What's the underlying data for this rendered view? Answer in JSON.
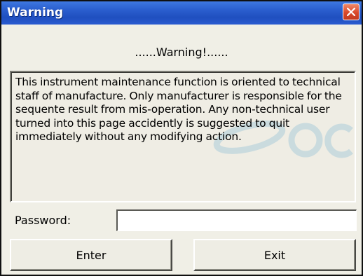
{
  "window": {
    "title": "Warning"
  },
  "dialog": {
    "heading": "......Warning!......",
    "message": "This instrument maintenance function is oriented to technical staff of manufacture. Only manufacturer is responsible for the sequente result from mis-operation. Any non-technical user turned into this page accidently is suggested to quit immediately without any modifying action.",
    "password_label": "Password:",
    "password_value": "",
    "enter_label": "Enter",
    "exit_label": "Exit"
  },
  "icons": {
    "close": "close-icon",
    "watermark": "logo-watermark"
  },
  "colors": {
    "titlebar": "#2b5fcf",
    "close_button": "#d9482a",
    "dialog_background": "#f0efe6"
  }
}
